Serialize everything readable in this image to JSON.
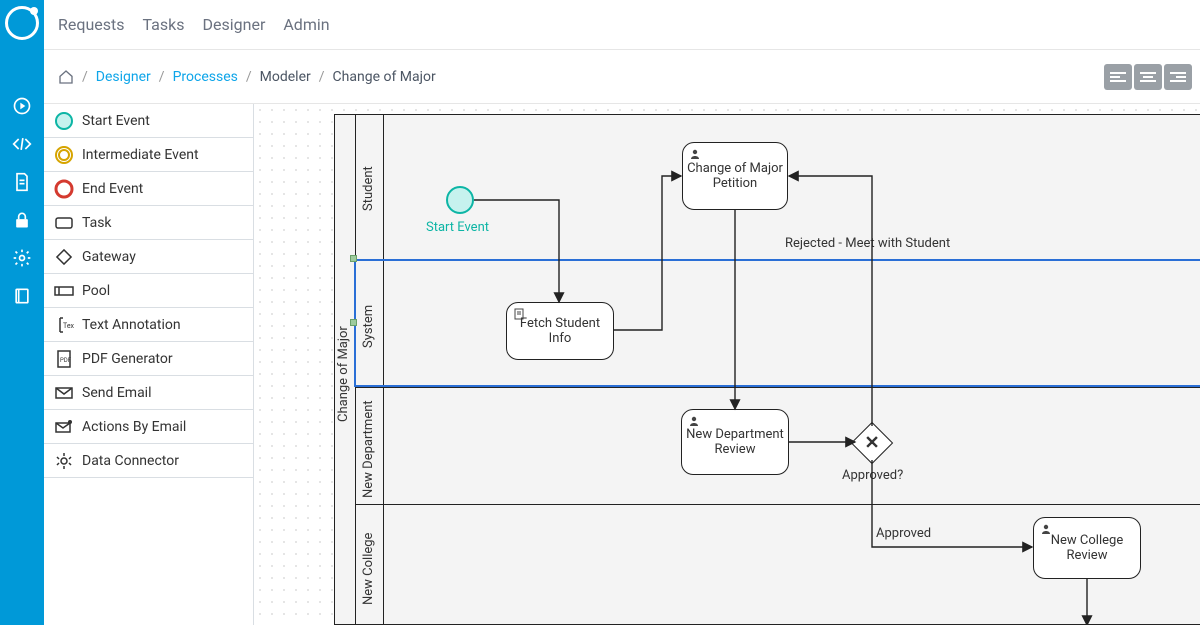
{
  "nav": {
    "items": [
      "Requests",
      "Tasks",
      "Designer",
      "Admin"
    ]
  },
  "breadcrumb": {
    "designer": "Designer",
    "processes": "Processes",
    "modeler": "Modeler",
    "current": "Change of Major"
  },
  "palette": {
    "items": [
      {
        "label": "Start Event"
      },
      {
        "label": "Intermediate Event"
      },
      {
        "label": "End Event"
      },
      {
        "label": "Task"
      },
      {
        "label": "Gateway"
      },
      {
        "label": "Pool"
      },
      {
        "label": "Text Annotation"
      },
      {
        "label": "PDF Generator"
      },
      {
        "label": "Send Email"
      },
      {
        "label": "Actions By Email"
      },
      {
        "label": "Data Connector"
      }
    ]
  },
  "pool": {
    "name": "Change of Major",
    "lanes": [
      "Student",
      "System",
      "New Department",
      "New College"
    ]
  },
  "nodes": {
    "start": {
      "label": "Start Event"
    },
    "change_petition": {
      "label": "Change of Major Petition"
    },
    "fetch_student": {
      "label": "Fetch Student Info"
    },
    "new_dept_review": {
      "label": "New Department Review"
    },
    "new_college_review": {
      "label": "New College Review"
    },
    "gateway_approved": {
      "label": "Approved?"
    }
  },
  "edges": {
    "rejected": "Rejected - Meet with Student",
    "approved": "Approved"
  },
  "icons": {
    "strip": [
      "play-icon",
      "code-icon",
      "document-icon",
      "lock-icon",
      "gear-icon",
      "book-icon"
    ]
  }
}
